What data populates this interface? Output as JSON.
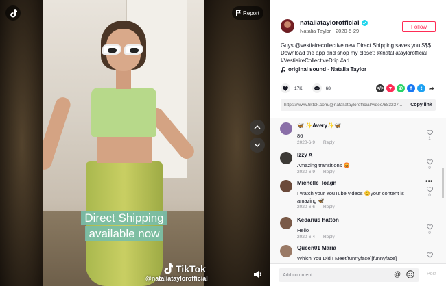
{
  "video": {
    "report_label": "Report",
    "caption": "Direct Shipping available now",
    "watermark_brand": "TikTok",
    "watermark_handle": "@nataliataylorofficial"
  },
  "author": {
    "username": "nataliataylorofficial",
    "display_name": "Natalia Taylor",
    "date": "2020-5-29",
    "follow_label": "Follow",
    "verified_icon": "verified-check-icon"
  },
  "post": {
    "description": "Guys @vestiairecollective new Direct Shipping saves you $$$. Download the app and shop my closet: @nataliataylorofficial #VestiaireCollectiveDrip #ad",
    "sound": "original sound - Natalia Taylor",
    "likes": "17K",
    "comments": "68",
    "link_url": "https://www.tiktok.com/@nataliataylorofficial/video/683237...",
    "copy_link_label": "Copy link"
  },
  "share_icons": [
    {
      "name": "embed-icon",
      "color": "#333333",
      "glyph": "</>"
    },
    {
      "name": "dm-send-icon",
      "color": "#fe2c55",
      "glyph": "▼"
    },
    {
      "name": "whatsapp-icon",
      "color": "#25d366",
      "glyph": "✆"
    },
    {
      "name": "facebook-icon",
      "color": "#1877f2",
      "glyph": "f"
    },
    {
      "name": "twitter-icon",
      "color": "#1da1f2",
      "glyph": "t"
    },
    {
      "name": "share-arrow-icon",
      "color": "#ffffff",
      "glyph": "➦"
    }
  ],
  "comments": [
    {
      "name": "🦋 ✨Avery✨🦋",
      "text": "86",
      "date": "2020-6-9",
      "reply": "Reply",
      "likes": "1",
      "avatar_color": "#8a6fa8"
    },
    {
      "name": "Izzy A",
      "text": "Amazing transitions 😡",
      "date": "2020-6-9",
      "reply": "Reply",
      "likes": "0",
      "avatar_color": "#3d3a36"
    },
    {
      "name": "Michelle_loagn_",
      "text": "I watch your YouTube videos 😊your content is amazing 🦋",
      "date": "2020-6-6",
      "reply": "Reply",
      "likes": "0",
      "avatar_color": "#6b4a3a"
    },
    {
      "name": "Kedarius hatton",
      "text": "Hello",
      "date": "2020-6-4",
      "reply": "Reply",
      "likes": "0",
      "avatar_color": "#7a5a48"
    },
    {
      "name": "Queen01 Maria",
      "text": "Which You Did I Meet[funnyface][funnyface]",
      "date": "",
      "reply": "",
      "likes": "",
      "avatar_color": "#9a7a66"
    }
  ],
  "comment_bar": {
    "placeholder": "Add comment...",
    "post_label": "Post"
  }
}
